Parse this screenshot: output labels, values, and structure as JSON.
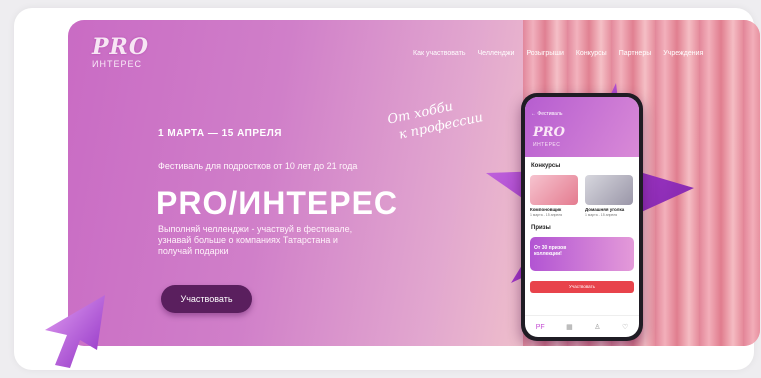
{
  "logo": {
    "main": "PRO",
    "sub": "ИНТЕРЕС"
  },
  "nav": [
    "Как участвовать",
    "Челленджи",
    "Розыгрыши",
    "Конкурсы",
    "Партнеры",
    "Учреждения"
  ],
  "hero": {
    "slogan_line1": "От хобби",
    "slogan_line2": "к профессии",
    "date": "1 МАРТА — 15 АПРЕЛЯ",
    "subtitle": "Фестиваль для подростков от 10 лет до 21 года",
    "title": "PRO/ИНТЕРЕС",
    "description": "Выполняй челленджи - участвуй в фестивале, узнавай больше о компаниях Татарстана и получай подарки",
    "cta": "Участвовать"
  },
  "phone": {
    "back_label": "← Фестиваль",
    "logo_main": "PRO",
    "logo_sub": "ИНТЕРЕС",
    "section_contests": "Конкурсы",
    "card1_title": "Компоновщик",
    "card1_date": "1 марта - 15 апреля",
    "card2_title": "Домашняя уголка",
    "card2_date": "1 марта - 15 апреля",
    "section_prizes": "Призы",
    "prize_text": "От 30 призов коллекции!",
    "action": "Участвовать",
    "tabs": [
      "PF",
      "▦",
      "♙",
      "♡"
    ]
  },
  "colors": {
    "accent": "#5a1f5e",
    "banner_start": "#c96bc4",
    "banner_end": "#ee9aa8",
    "cta_red": "#e8434b"
  }
}
